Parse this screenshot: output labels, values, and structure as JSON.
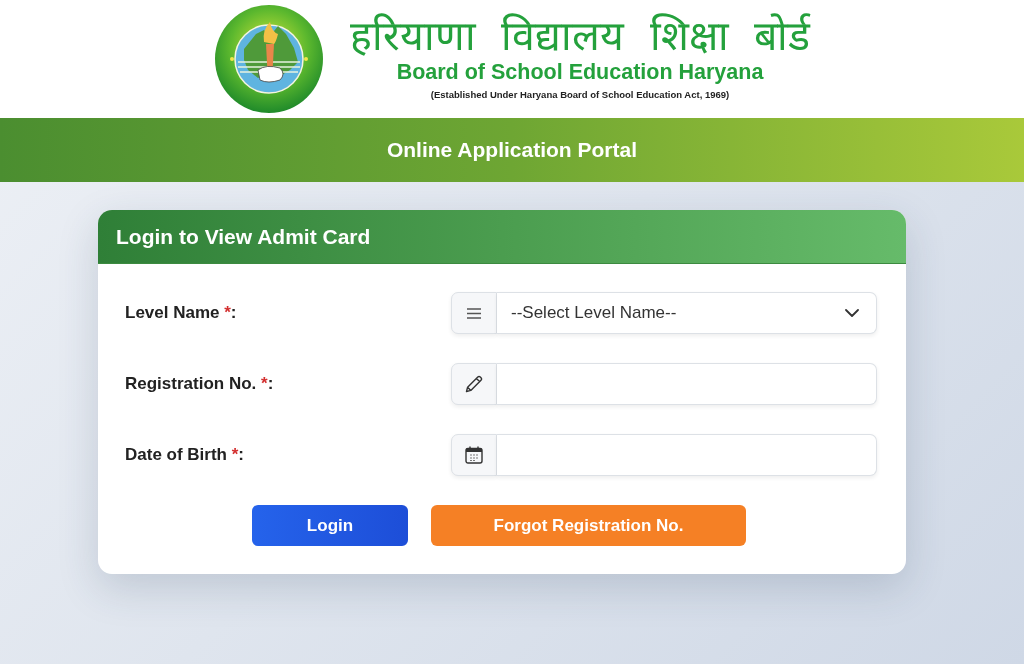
{
  "header": {
    "title_hindi": "हरियाणा विद्यालय शिक्षा बोर्ड",
    "title_english": "Board of School Education Haryana",
    "subtitle": "(Established Under Haryana Board of School Education Act, 1969)"
  },
  "banner": {
    "title": "Online Application Portal"
  },
  "login_card": {
    "title": "Login to View Admit Card",
    "fields": [
      {
        "kind": "select",
        "label": "Level Name",
        "required_mark": "*",
        "suffix": ":",
        "placeholder": "--Select Level Name--"
      },
      {
        "kind": "text",
        "label": "Registration No.",
        "required_mark": "*",
        "suffix": ":"
      },
      {
        "kind": "date",
        "label": "Date of Birth",
        "required_mark": "*",
        "suffix": ":"
      }
    ],
    "buttons": [
      {
        "kind": "primary",
        "label": "Login"
      },
      {
        "kind": "warning",
        "label": "Forgot Registration No."
      }
    ]
  }
}
